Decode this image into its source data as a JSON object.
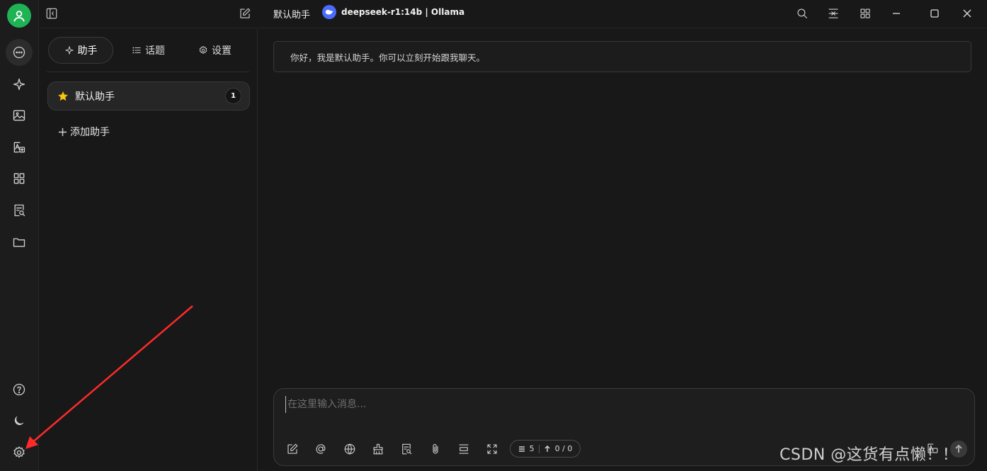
{
  "rail": {
    "items": [
      "chat-icon",
      "sparkle-icon",
      "image-icon",
      "translate-icon",
      "apps-icon",
      "knowledge-search-icon",
      "folder-icon"
    ],
    "bottom_items": [
      "help-icon",
      "moon-icon",
      "gear-icon"
    ],
    "avatar_color": "#1fb355"
  },
  "topbar": {
    "assistant_title": "默认助手",
    "model_name": "deepseek-r1:14b | Ollama",
    "model_logo_color": "#4b6bfb"
  },
  "panel": {
    "tabs": [
      {
        "label": "助手",
        "icon": "sparkle-icon",
        "active": true
      },
      {
        "label": "话题",
        "icon": "list-icon",
        "active": false
      },
      {
        "label": "设置",
        "icon": "gear-icon",
        "active": false
      }
    ],
    "assistants": [
      {
        "name": "默认助手",
        "icon": "star-icon",
        "topic_count": "1"
      }
    ],
    "add_assistant_label": "添加助手"
  },
  "chat": {
    "greeting": "你好，我是默认助手。你可以立刻开始跟我聊天。"
  },
  "composer": {
    "placeholder": "在这里输入消息...",
    "context_count": "5",
    "token_usage": "0 / 0"
  },
  "watermark": "CSDN @这货有点懒！！"
}
